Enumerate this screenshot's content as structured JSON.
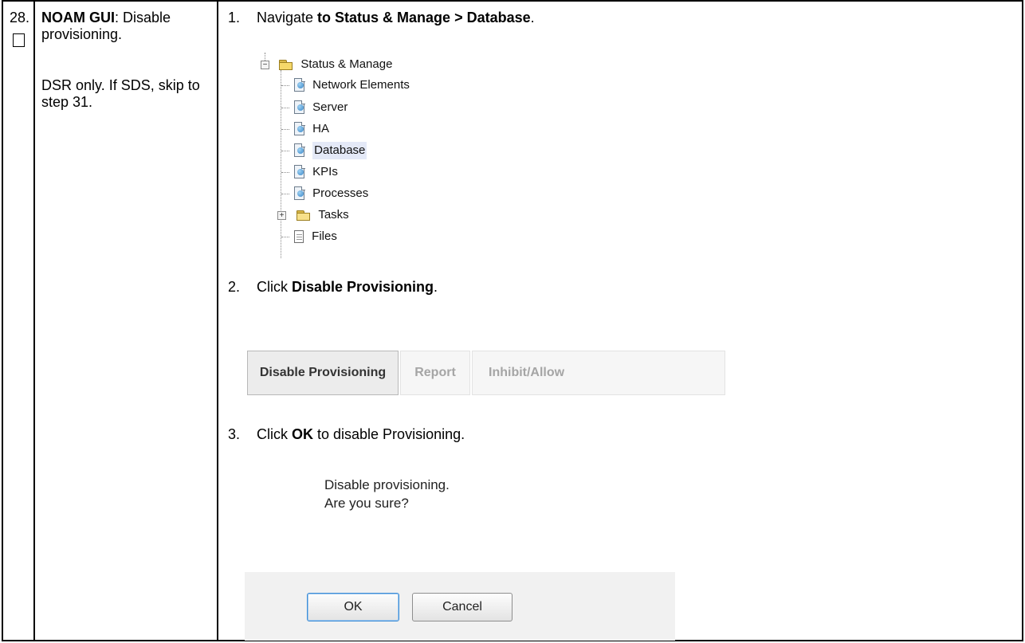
{
  "step": {
    "number": "28.",
    "title_bold": "NOAM GUI",
    "title_rest": ": Disable provisioning.",
    "note": "DSR only.  If SDS, skip to step 31."
  },
  "instructions": [
    {
      "n": "1.",
      "pre": "Navigate ",
      "bold": "to Status & Manage > Database",
      "post": "."
    },
    {
      "n": "2.",
      "pre": "Click ",
      "bold": "Disable Provisioning",
      "post": "."
    },
    {
      "n": "3.",
      "pre": "Click ",
      "bold": "OK",
      "post": " to disable Provisioning."
    }
  ],
  "tree": {
    "root": "Status & Manage",
    "items": [
      {
        "label": "Network Elements",
        "icon": "page-globe-icon"
      },
      {
        "label": "Server",
        "icon": "page-globe-icon"
      },
      {
        "label": "HA",
        "icon": "page-globe-icon"
      },
      {
        "label": "Database",
        "icon": "page-globe-icon",
        "selected": true
      },
      {
        "label": "KPIs",
        "icon": "page-globe-icon"
      },
      {
        "label": "Processes",
        "icon": "page-globe-icon"
      },
      {
        "label": "Tasks",
        "icon": "folder-icon"
      },
      {
        "label": "Files",
        "icon": "document-icon"
      }
    ]
  },
  "buttons": {
    "disable_provisioning": "Disable Provisioning",
    "report": "Report",
    "inhibit_allow": "Inhibit/Allow"
  },
  "dialog": {
    "line1": "Disable provisioning.",
    "line2": "Are you sure?",
    "ok": "OK",
    "cancel": "Cancel"
  }
}
